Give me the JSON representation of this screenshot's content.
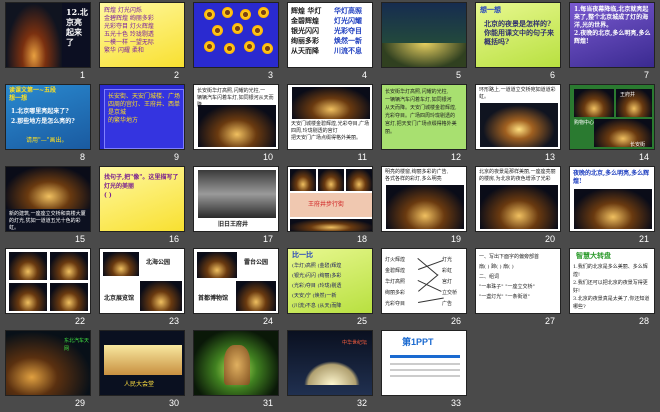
{
  "slides": {
    "s1": {
      "num": "1",
      "title": "12.北京亮起来了"
    },
    "s2": {
      "num": "2",
      "lines": "辉煌  灯光闪烁\n金碧辉煌  绚丽多彩\n光彩夺目  灯火辉煌\n五光十色  玲珑剔透\n一模一样  一望无际\n繁华  闪耀  柔和"
    },
    "s3": {
      "num": "3"
    },
    "s4": {
      "num": "4",
      "left": "辉煌   华灯\n金碧辉煌\n银光闪闪\n绚丽多彩\n从天而降",
      "right": "华灯高照\n灯光闪耀\n光彩夺目\n焕然一新\n川流不息"
    },
    "s5": {
      "num": "5"
    },
    "s6": {
      "num": "6",
      "head": "想一想",
      "body": "北京的夜景是怎样的?你能用课文中的句子来概括吗?"
    },
    "s7": {
      "num": "7",
      "body": "1.每当夜幕降临,北京就亮起来了,整个北京城成了灯的海洋,光的世界。\n2.夜晚的北京,多么明亮,多么辉煌!"
    },
    "s8": {
      "num": "8",
      "head": "读课文第一~五段\n想一想",
      "body": "1.北京哪里亮起来了?\n2.那些地方是怎么亮的?",
      "hint": "请用\"—\"画出。"
    },
    "s9": {
      "num": "9",
      "body": "长安街、天安门城楼、广场四周的宫灯、王府井、西单是京城\n的繁华地方"
    },
    "s10": {
      "num": "10",
      "body": "长安街华灯高照,闪耀的光柱,一\n辆辆汽车闪着车灯,如同银河从天而降"
    },
    "s11": {
      "num": "11",
      "body": "天安门城楼金碧辉煌,光彩夺目,广场四周,玲珑剔透的宫灯\n把天安门广场点缀得格外美丽。"
    },
    "s12": {
      "num": "12",
      "body": "长安街华灯高照,闪耀的光柱,\n一辆辆汽车闪着车灯,如同银河\n从天而降。天安门城楼金碧辉煌,\n光彩夺目。广场四周玲珑剔透的\n宫灯,把天安门广场点缀得格外美丽。"
    },
    "s13": {
      "num": "13",
      "body": "环形路上,一道道立交桥宛如道道彩虹。"
    },
    "s14": {
      "num": "14",
      "tags": [
        "购物中心",
        "王府井",
        "长安街"
      ]
    },
    "s15": {
      "num": "15",
      "body": "新的建筑,一座座立交桥和高楼大厦的灯光,犹如一道道五光十色的彩虹。"
    },
    "s16": {
      "num": "16",
      "body": "找句子,把\"像\"。这里描写了\n灯光的美丽\n(    )"
    },
    "s17": {
      "num": "17",
      "caption": "旧日王府井"
    },
    "s18": {
      "num": "18",
      "body": "王府井步行街"
    },
    "s19": {
      "num": "19",
      "body": "明亮的楼窗,绚丽多彩的广告,\n各式各样的彩灯,多么明亮"
    },
    "s20": {
      "num": "20",
      "body": "北京的夜景是那样美丽,一座座亮丽\n的楼房,为北京的夜色增添了光彩"
    },
    "s21": {
      "num": "21",
      "body": "夜晚的北京,多么明亮,多么辉煌!"
    },
    "s22": {
      "num": "22"
    },
    "s23": {
      "num": "23",
      "labels": [
        "北海公园",
        "北京展览馆"
      ]
    },
    "s24": {
      "num": "24",
      "labels": [
        "雷台公园",
        "首都博物馆"
      ]
    },
    "s25": {
      "num": "25",
      "head": "比一比",
      "body": "(华灯)高照   (金碧)辉煌\n(银光)闪闪   (绚丽)多彩\n(光彩)夺目   (玲珑)剔透\n(天安)宁   (焕然)一新\n(川流)不息   (从天)而降"
    },
    "s26": {
      "num": "26",
      "left": "灯火辉煌\n金碧辉煌\n华灯高照\n绚丽多彩\n光彩夺目",
      "right": "灯光\n彩虹\n宫灯\n立交桥\n广告"
    },
    "s27": {
      "num": "27",
      "body": "一、写出下面字的偏旁部首\n扇(  )  蹄(  )  扇(  )\n二、组词\n\"一串珠子\" \"一座立交桥\"\n\"一盏灯光\" \"一条街道\""
    },
    "s28": {
      "num": "28",
      "head": "智慧大转盘",
      "body": "1.我们的北京是多么美丽、多么辉煌!\n2.我们还可以把北京的夜景写得更好!\n3.北京的夜景真是太美了,你还知道哪些?"
    },
    "s29": {
      "num": "29",
      "label": "东北汽车天网"
    },
    "s30": {
      "num": "30",
      "label": "人民大会堂"
    },
    "s31": {
      "num": "31"
    },
    "s32": {
      "num": "32",
      "label": "中华世纪坛"
    },
    "s33": {
      "num": "33",
      "logo": "第1PPT"
    }
  }
}
